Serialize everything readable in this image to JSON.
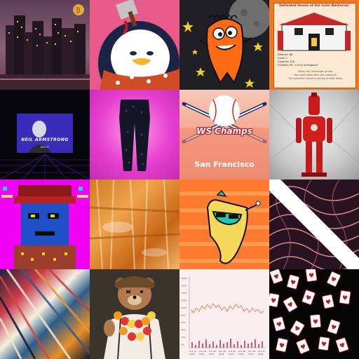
{
  "gallery": {
    "tiles": [
      {
        "name": "pixel-city-night"
      },
      {
        "name": "penguin-with-cleaver"
      },
      {
        "name": "orange-monster-on-moon"
      },
      {
        "name": "pixel-house-of-barbarian"
      },
      {
        "name": "neil-armstrong-poster"
      },
      {
        "name": "leggings-on-pink"
      },
      {
        "name": "ws-champs-san-francisco"
      },
      {
        "name": "red-robot-figure"
      },
      {
        "name": "pixel-punk-face"
      },
      {
        "name": "orange-abstract-painting"
      },
      {
        "name": "cartoon-sticker-character"
      },
      {
        "name": "swirl-pattern-diagonal"
      },
      {
        "name": "glitch-streaks"
      },
      {
        "name": "bear-with-lei"
      },
      {
        "name": "price-chart"
      },
      {
        "name": "floating-cards"
      }
    ],
    "texts": {
      "house_title": "Defended House of the Color Barbarian",
      "house_stats": [
        "Defense: 88",
        "Guild: 0",
        "Capacity: 106",
        "Chieftain HP: +10 to intelligence"
      ],
      "house_caption": [
        "When the challenger arrives",
        "the castle defenders will protect it.",
        "The barbarian house is strong as their allies."
      ],
      "neil_name": "NEIL ARMSTRONG",
      "neil_sub": "BRCOT",
      "ws_champs": "WS Champs",
      "san_francisco": "San Francisco",
      "chart_yaxis": [
        "180%",
        "160%",
        "140%",
        "120%",
        "100%",
        "80%",
        "60%",
        "40%",
        "20%",
        "0%"
      ],
      "chart_xaxis": [
        "Oct 14\n2021",
        "Oct 28\n2021",
        "Oct 28\n2021",
        "Oct 28\n2021",
        "Oct 28\n2021",
        "Oct 28\n2021",
        "Oct 28\n2021",
        "Oct 17\n2021"
      ]
    }
  },
  "colors": {
    "ws_red": "#b3182a",
    "house_bg": "#f07a24",
    "punk_face": "#1e4fc7",
    "chart_line": "#e8854a"
  }
}
